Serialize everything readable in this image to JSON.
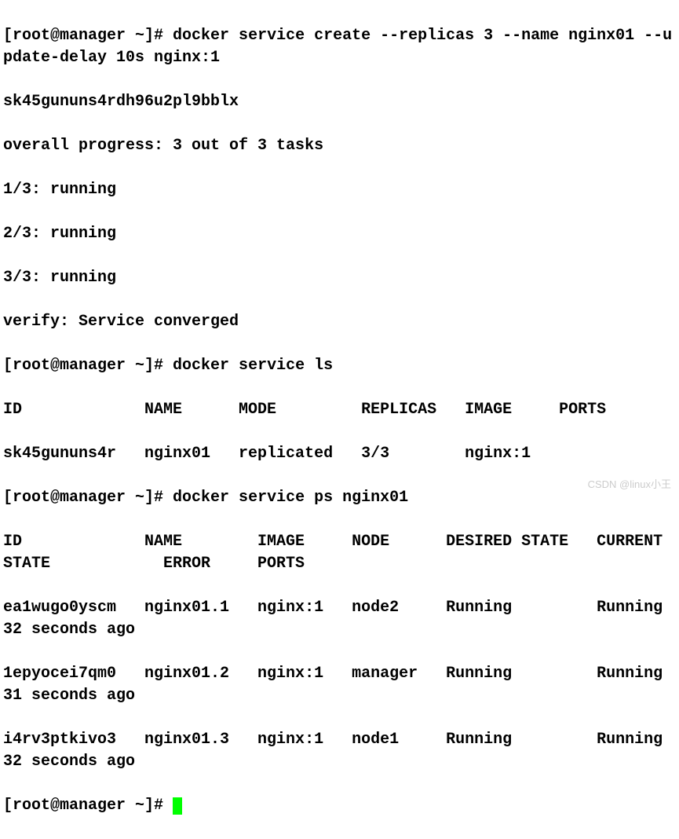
{
  "terminal": {
    "prompt": "[root@manager ~]# ",
    "cmd_create": "docker service create --replicas 3 --name nginx01 --update-delay 10s nginx:1",
    "service_id": "sk45gununs4rdh96u2pl9bblx",
    "progress": "overall progress: 3 out of 3 tasks",
    "task1": "1/3: running",
    "task2": "2/3: running",
    "task3": "3/3: running",
    "verify": "verify: Service converged",
    "cmd_ls": "docker service ls",
    "ls_header": "ID             NAME      MODE         REPLICAS   IMAGE     PORTS",
    "ls_row": "sk45gununs4r   nginx01   replicated   3/3        nginx:1",
    "cmd_ps": "docker service ps nginx01",
    "ps_header": "ID             NAME        IMAGE     NODE      DESIRED STATE   CURRENT STATE            ERROR     PORTS",
    "ps_row1": "ea1wugo0yscm   nginx01.1   nginx:1   node2     Running         Running 32 seconds ago",
    "ps_row2": "1epyocei7qm0   nginx01.2   nginx:1   manager   Running         Running 31 seconds ago",
    "ps_row3": "i4rv3ptkivo3   nginx01.3   nginx:1   node1     Running         Running 32 seconds ago"
  },
  "watermark": "CSDN @linux小王"
}
